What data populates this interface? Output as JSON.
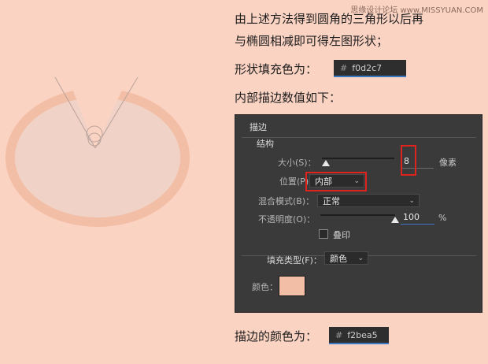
{
  "watermark": "思缘设计论坛 www.MISSYUAN.COM",
  "colors": {
    "background": "#fbd3c3",
    "ellipse_fill": "#f0d2c7",
    "ellipse_stroke": "#f2bea5",
    "panel": "#3a3a3a",
    "highlight": "#e0231f",
    "input_underline": "#3b78c2"
  },
  "description": {
    "line1": "由上述方法得到圆角的三角形以后再",
    "line2": "与椭圆相减即可得左图形状；"
  },
  "fill": {
    "label": "形状填充色为：",
    "hash": "#",
    "value": "f0d2c7"
  },
  "stroke_intro": "内部描边数值如下：",
  "panel": {
    "title": "描边",
    "structure": {
      "title": "结构",
      "size_label": "大小(S)：",
      "size_value": "8",
      "size_unit": "像素",
      "size_slider": 0.05,
      "position_label": "位置(P)：",
      "position_value": "内部",
      "blend_label": "混合模式(B)：",
      "blend_value": "正常",
      "opacity_label": "不透明度(O)：",
      "opacity_value": "100",
      "opacity_unit": "%",
      "opacity_slider": 1.0,
      "overprint_label": "叠印"
    },
    "fill_type": {
      "label": "填充类型(F)：",
      "value": "颜色",
      "color_label": "颜色："
    }
  },
  "stroke_color": {
    "label": "描边的颜色为：",
    "hash": "#",
    "value": "f2bea5"
  },
  "icons": {
    "chevron": "chevron-down-icon",
    "slider": "slider-knob-icon"
  }
}
